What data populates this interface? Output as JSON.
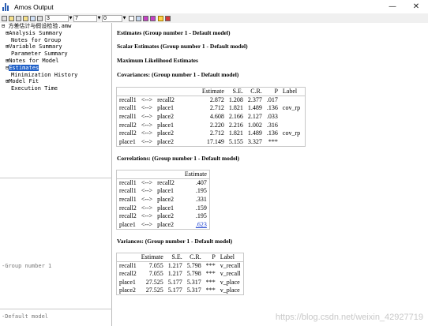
{
  "window": {
    "title": "Amos Output",
    "minimize": "—",
    "close": "✕"
  },
  "toolbar": {
    "select1_value": "3",
    "select2_value": "7",
    "select3_value": "0"
  },
  "tree": {
    "root": "方差估计与假设检验.amw",
    "items": [
      {
        "prefix": "⊞",
        "label": "Analysis Summary"
      },
      {
        "prefix": "",
        "label": "Notes for Group"
      },
      {
        "prefix": "⊞",
        "label": "Variable Summary"
      },
      {
        "prefix": "",
        "label": "Parameter Summary"
      },
      {
        "prefix": "⊞",
        "label": "Notes for Model"
      },
      {
        "prefix": "⊟",
        "label": "Estimates"
      },
      {
        "prefix": "",
        "label": "Minimization History"
      },
      {
        "prefix": "⊞",
        "label": "Model Fit"
      },
      {
        "prefix": "",
        "label": "Execution Time"
      }
    ]
  },
  "group_pane": {
    "label": "Group number 1"
  },
  "model_pane": {
    "label": "Default model"
  },
  "output": {
    "h1": "Estimates (Group number 1 - Default model)",
    "h2": "Scalar Estimates (Group number 1 - Default model)",
    "h3": "Maximum Likelihood Estimates",
    "h4": "Covariances: (Group number 1 - Default model)",
    "h5": "Correlations: (Group number 1 - Default model)",
    "h6": "Variances: (Group number 1 - Default model)"
  },
  "covariances": {
    "headers": [
      "",
      "",
      "",
      "Estimate",
      "S.E.",
      "C.R.",
      "P",
      "Label"
    ],
    "rows": [
      [
        "recall1",
        "<-->",
        "recall2",
        "2.872",
        "1.208",
        "2.377",
        ".017",
        ""
      ],
      [
        "recall1",
        "<-->",
        "place1",
        "2.712",
        "1.821",
        "1.489",
        ".136",
        "cov_rp"
      ],
      [
        "recall1",
        "<-->",
        "place2",
        "4.608",
        "2.166",
        "2.127",
        ".033",
        ""
      ],
      [
        "recall2",
        "<-->",
        "place1",
        "2.220",
        "2.216",
        "1.002",
        ".316",
        ""
      ],
      [
        "recall2",
        "<-->",
        "place2",
        "2.712",
        "1.821",
        "1.489",
        ".136",
        "cov_rp"
      ],
      [
        "place1",
        "<-->",
        "place2",
        "17.149",
        "5.155",
        "3.327",
        "***",
        ""
      ]
    ]
  },
  "correlations": {
    "headers": [
      "",
      "",
      "",
      "Estimate"
    ],
    "rows": [
      [
        "recall1",
        "<-->",
        "recall2",
        ".407"
      ],
      [
        "recall1",
        "<-->",
        "place1",
        ".195"
      ],
      [
        "recall1",
        "<-->",
        "place2",
        ".331"
      ],
      [
        "recall2",
        "<-->",
        "place1",
        ".159"
      ],
      [
        "recall2",
        "<-->",
        "place2",
        ".195"
      ],
      [
        "place1",
        "<-->",
        "place2",
        ".623"
      ]
    ]
  },
  "variances": {
    "headers": [
      "",
      "Estimate",
      "S.E.",
      "C.R.",
      "P",
      "Label"
    ],
    "rows": [
      [
        "recall1",
        "7.055",
        "1.217",
        "5.798",
        "***",
        "v_recall"
      ],
      [
        "recall2",
        "7.055",
        "1.217",
        "5.798",
        "***",
        "v_recall"
      ],
      [
        "place1",
        "27.525",
        "5.177",
        "5.317",
        "***",
        "v_place"
      ],
      [
        "place2",
        "27.525",
        "5.177",
        "5.317",
        "***",
        "v_place"
      ]
    ]
  },
  "watermark": "https://blog.csdn.net/weixin_42927719"
}
